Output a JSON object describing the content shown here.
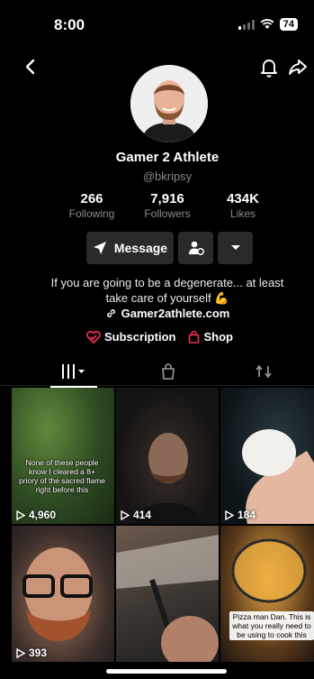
{
  "status": {
    "time": "8:00",
    "battery": "74"
  },
  "profile": {
    "name": "Gamer 2 Athlete",
    "handle": "@bkripsy",
    "stats": [
      {
        "value": "266",
        "label": "Following"
      },
      {
        "value": "7,916",
        "label": "Followers"
      },
      {
        "value": "434K",
        "label": "Likes"
      }
    ],
    "message_label": "Message",
    "bio_line1": "If you are going to be a degenerate... at least",
    "bio_line2": "take care of yourself",
    "bio_emoji": "💪",
    "link": "Gamer2athlete.com",
    "subscription_label": "Subscription",
    "shop_label": "Shop"
  },
  "videos": [
    {
      "views": "4,960",
      "caption": "None of these people know I cleared a 8+ priory of the sacred flame right before this"
    },
    {
      "views": "414",
      "caption": ""
    },
    {
      "views": "184",
      "caption": ""
    },
    {
      "views": "393",
      "caption": ""
    },
    {
      "views": "",
      "caption": ""
    },
    {
      "views": "",
      "caption": "Pizza man Dan. This is what you really need to be using to cook this"
    }
  ],
  "colors": {
    "background": "#000000",
    "button": "#2a2a2a",
    "muted": "#8a8a8a",
    "accent_red": "#fe2c55"
  },
  "icons": [
    "back-icon",
    "bell-icon",
    "share-icon",
    "message-send-icon",
    "add-friend-icon",
    "chevron-down-icon",
    "link-icon",
    "subscription-icon",
    "shop-bag-icon",
    "videos-grid-icon",
    "repost-icon",
    "play-icon"
  ]
}
